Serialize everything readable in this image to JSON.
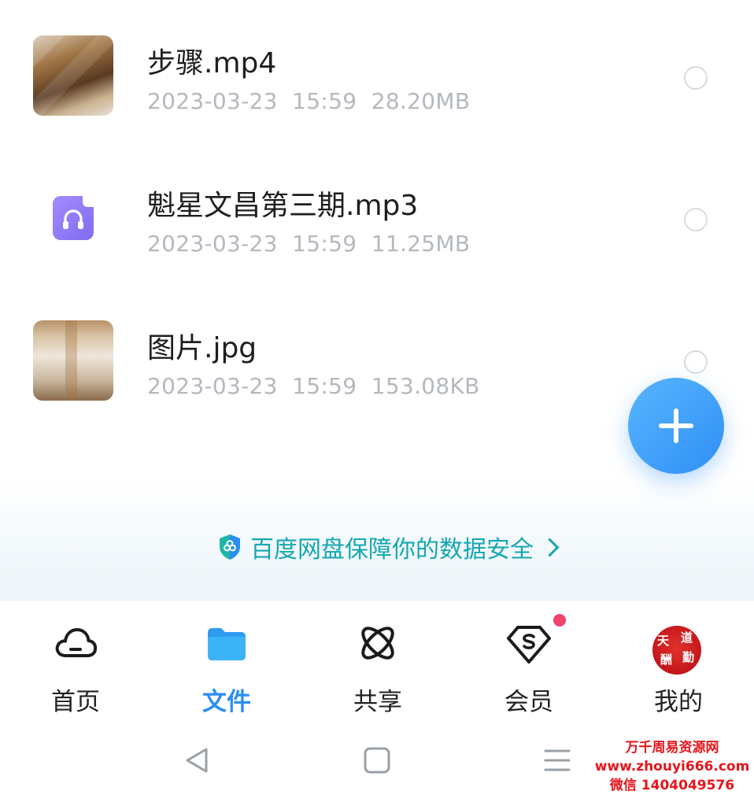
{
  "files": [
    {
      "name": "步骤.mp4",
      "date": "2023-03-23",
      "time": "15:59",
      "size": "28.20MB",
      "thumb": "video-thumbnail"
    },
    {
      "name": "魁星文昌第三期.mp3",
      "date": "2023-03-23",
      "time": "15:59",
      "size": "11.25MB",
      "thumb": "audio-file-icon"
    },
    {
      "name": "图片.jpg",
      "date": "2023-03-23",
      "time": "15:59",
      "size": "153.08KB",
      "thumb": "image-thumbnail"
    }
  ],
  "fab": {
    "icon": "plus-icon"
  },
  "security": {
    "text": "百度网盘保障你的数据安全",
    "color": "#14a7b2"
  },
  "tabs": [
    {
      "label": "首页",
      "icon": "cloud-icon"
    },
    {
      "label": "文件",
      "icon": "folder-icon",
      "active": true
    },
    {
      "label": "共享",
      "icon": "orbit-icon"
    },
    {
      "label": "会员",
      "icon": "vip-diamond-icon",
      "badge": true
    },
    {
      "label": "我的",
      "icon": "avatar"
    }
  ],
  "avatar": {
    "chars": [
      "天",
      "道",
      "酬",
      "勤"
    ]
  },
  "accent": "#2c8ef2",
  "watermark": {
    "line1": "万千周易资源网",
    "line2": "www.zhouyi666.com",
    "line3": "微信 1404049576"
  }
}
